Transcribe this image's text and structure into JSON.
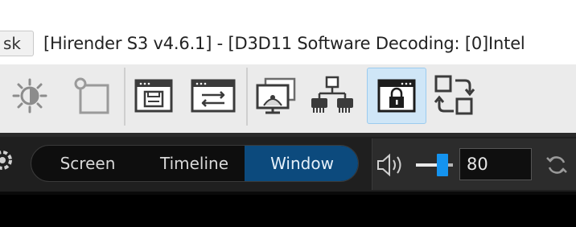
{
  "window": {
    "tab_label": "sk",
    "title": "[Hirender S3 v4.6.1] - [D3D11 Software Decoding: [0]Intel"
  },
  "toolbar": {
    "tools": [
      {
        "icon": "brightness-icon"
      },
      {
        "icon": "crop-frame-icon"
      },
      {
        "icon": "window-save-icon"
      },
      {
        "icon": "window-swap-icon"
      },
      {
        "icon": "projector-screen-icon"
      },
      {
        "icon": "network-icon"
      },
      {
        "icon": "lock-window-icon",
        "active": true
      },
      {
        "icon": "swap-layout-icon"
      }
    ]
  },
  "controls": {
    "modes": [
      "Screen",
      "Timeline",
      "Window"
    ],
    "selected_mode": "Window",
    "volume_value": "80",
    "volume_level": 0.8
  },
  "colors": {
    "selected_mode": "#0c4a7d",
    "slider_thumb": "#1493ef",
    "active_tool": "#cfe6f7"
  }
}
